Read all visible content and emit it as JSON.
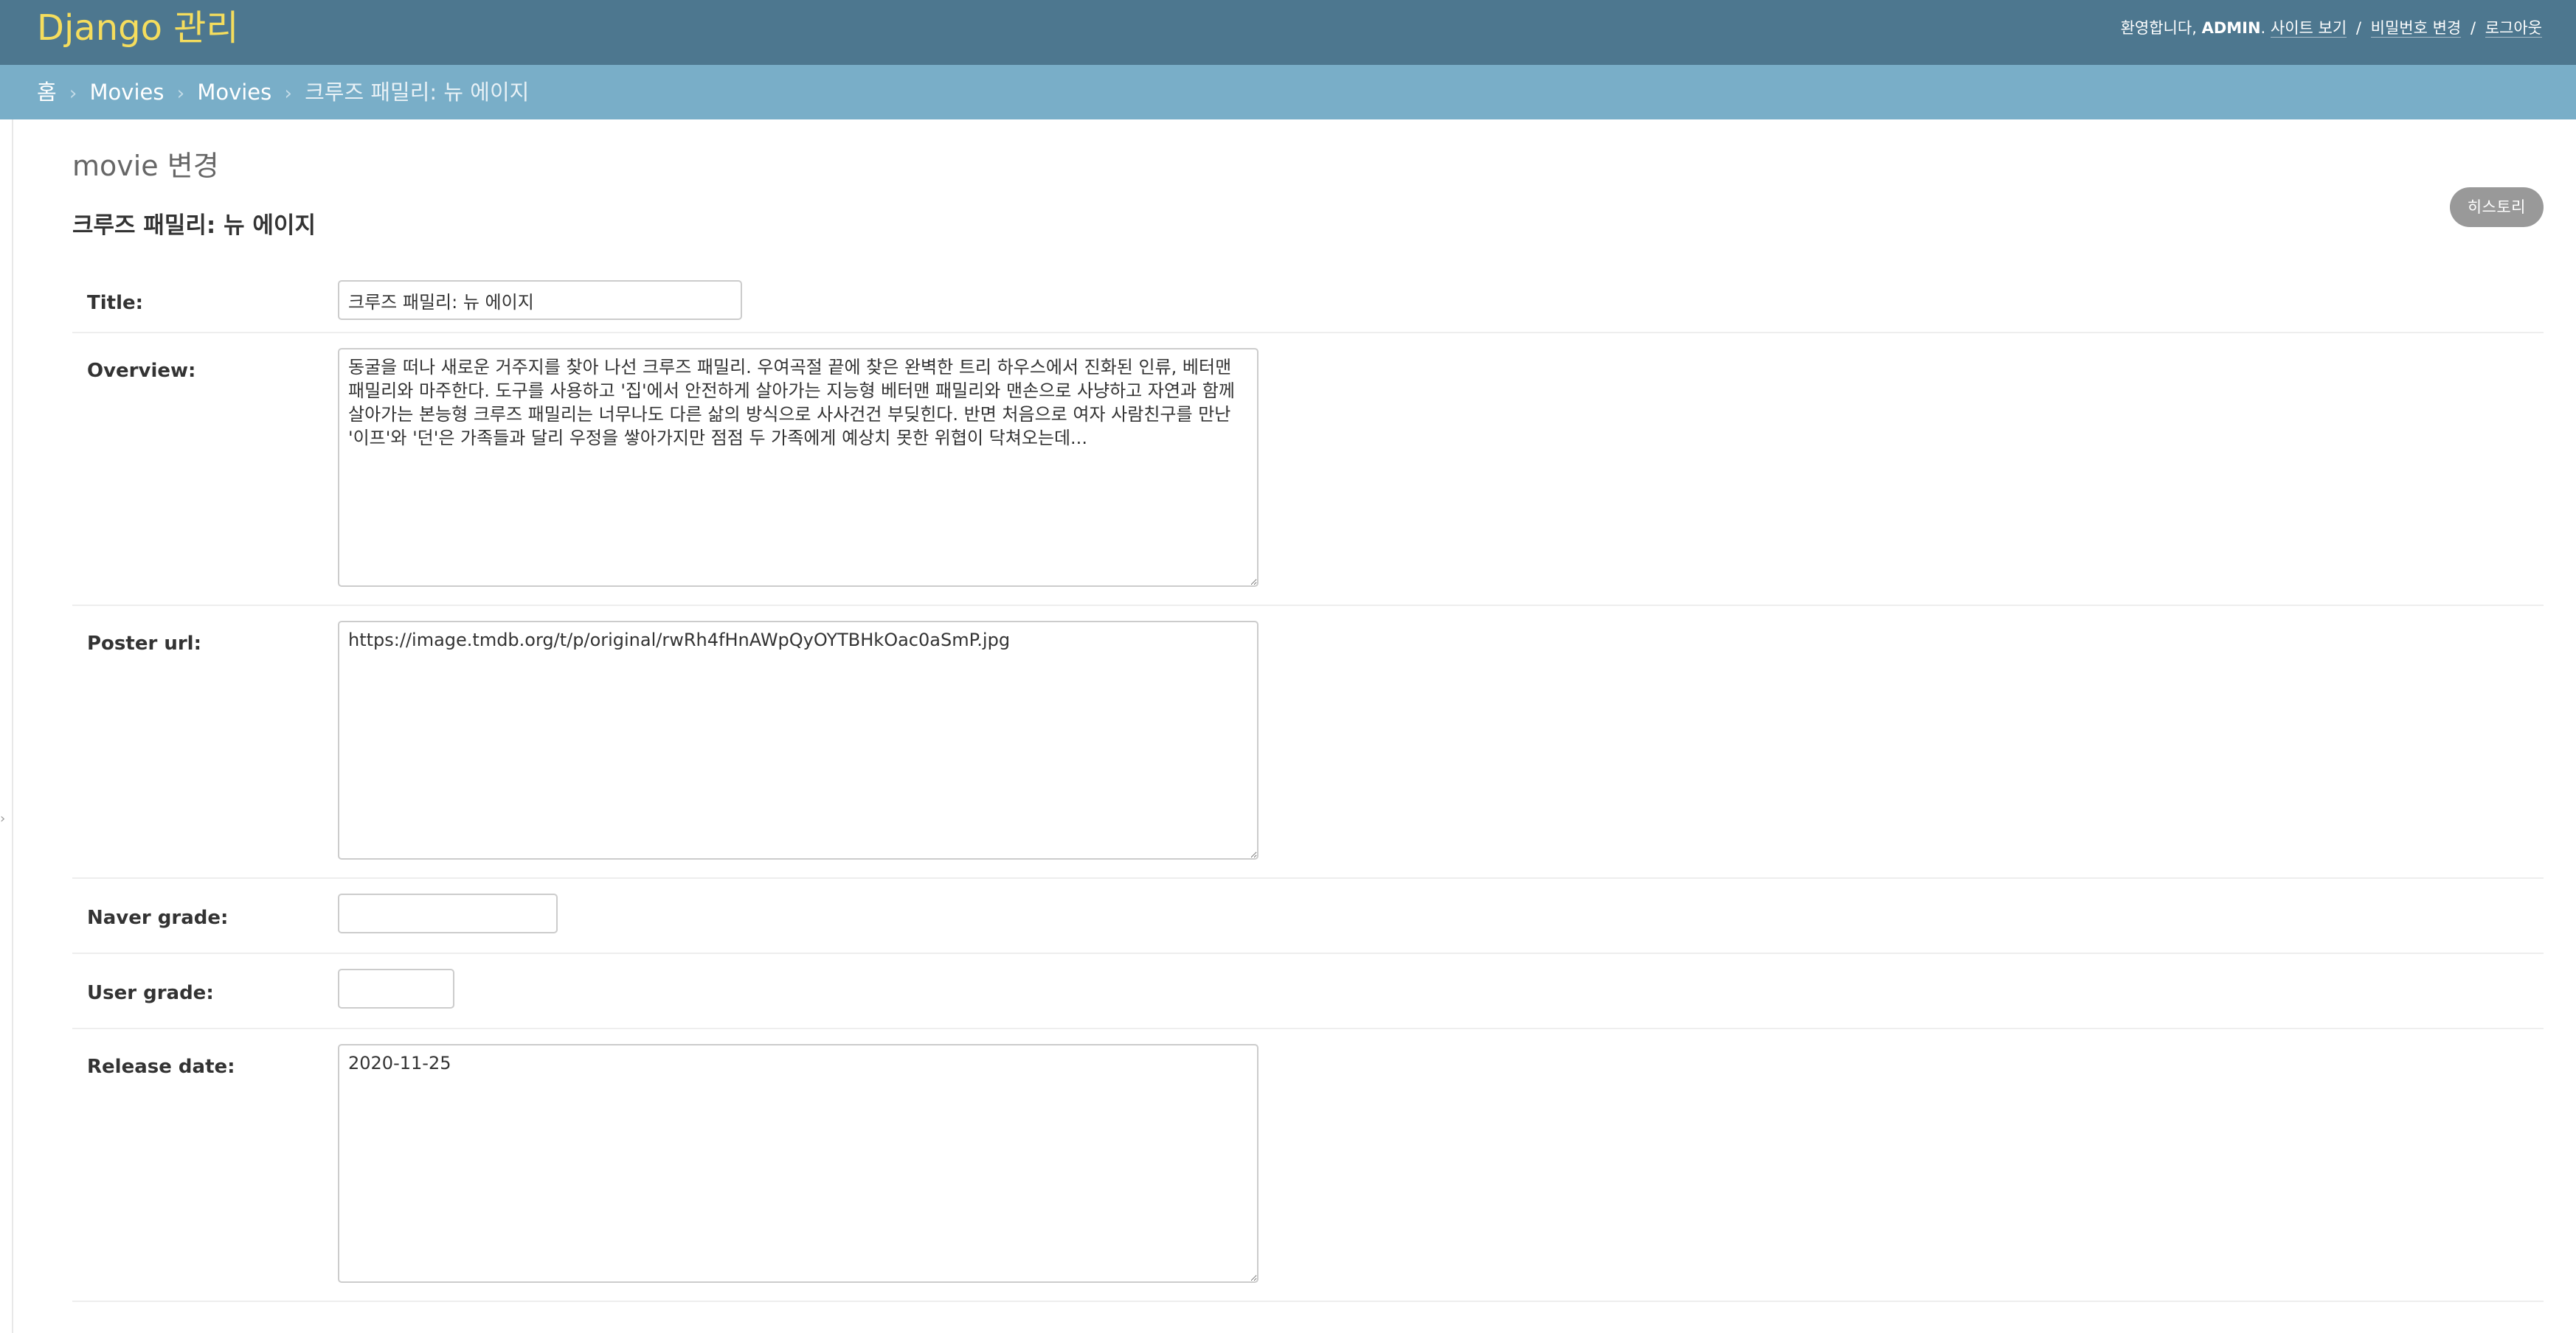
{
  "header": {
    "brand": "Django 관리",
    "welcome": "환영합니다,",
    "username": "ADMIN",
    "links": {
      "view_site": "사이트 보기",
      "change_password": "비밀번호 변경",
      "logout": "로그아웃"
    },
    "separator": "/"
  },
  "breadcrumbs": {
    "home": "홈",
    "app": "Movies",
    "model": "Movies",
    "current": "크루즈 패밀리: 뉴 에이지",
    "separator": "›"
  },
  "page": {
    "title": "movie 변경",
    "object_title": "크루즈 패밀리: 뉴 에이지",
    "history_button": "히스토리"
  },
  "form": {
    "title": {
      "label": "Title:",
      "value": "크루즈 패밀리: 뉴 에이지"
    },
    "overview": {
      "label": "Overview:",
      "value": "동굴을 떠나 새로운 거주지를 찾아 나선 크루즈 패밀리. 우여곡절 끝에 찾은 완벽한 트리 하우스에서 진화된 인류, 베터맨 패밀리와 마주한다. 도구를 사용하고 '집'에서 안전하게 살아가는 지능형 베터맨 패밀리와 맨손으로 사냥하고 자연과 함께 살아가는 본능형 크루즈 패밀리는 너무나도 다른 삶의 방식으로 사사건건 부딪힌다. 반면 처음으로 여자 사람친구를 만난 '이프'와 '던'은 가족들과 달리 우정을 쌓아가지만 점점 두 가족에게 예상치 못한 위협이 닥쳐오는데..."
    },
    "poster_url": {
      "label": "Poster url:",
      "value": "https://image.tmdb.org/t/p/original/rwRh4fHnAWpQyOYTBHkOac0aSmP.jpg"
    },
    "naver_grade": {
      "label": "Naver grade:",
      "value": ""
    },
    "user_grade": {
      "label": "User grade:",
      "value": ""
    },
    "release_date": {
      "label": "Release date:",
      "value": "2020-11-25"
    }
  },
  "icons": {
    "sidebar_toggle": "chevron-right-icon"
  },
  "colors": {
    "header_bg": "#4d778f",
    "brand": "#f5dd5d",
    "breadcrumbs_bg": "#79aec8",
    "history_button_bg": "#999999"
  }
}
